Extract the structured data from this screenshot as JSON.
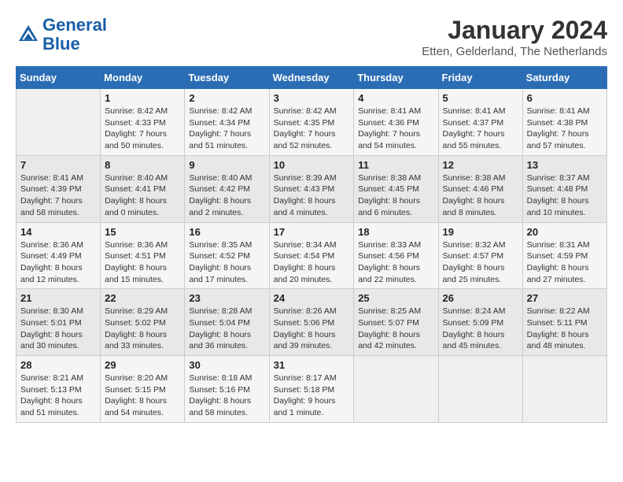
{
  "header": {
    "logo_line1": "General",
    "logo_line2": "Blue",
    "month_year": "January 2024",
    "location": "Etten, Gelderland, The Netherlands"
  },
  "days_of_week": [
    "Sunday",
    "Monday",
    "Tuesday",
    "Wednesday",
    "Thursday",
    "Friday",
    "Saturday"
  ],
  "weeks": [
    [
      {
        "day": "",
        "sunrise": "",
        "sunset": "",
        "daylight": ""
      },
      {
        "day": "1",
        "sunrise": "Sunrise: 8:42 AM",
        "sunset": "Sunset: 4:33 PM",
        "daylight": "Daylight: 7 hours and 50 minutes."
      },
      {
        "day": "2",
        "sunrise": "Sunrise: 8:42 AM",
        "sunset": "Sunset: 4:34 PM",
        "daylight": "Daylight: 7 hours and 51 minutes."
      },
      {
        "day": "3",
        "sunrise": "Sunrise: 8:42 AM",
        "sunset": "Sunset: 4:35 PM",
        "daylight": "Daylight: 7 hours and 52 minutes."
      },
      {
        "day": "4",
        "sunrise": "Sunrise: 8:41 AM",
        "sunset": "Sunset: 4:36 PM",
        "daylight": "Daylight: 7 hours and 54 minutes."
      },
      {
        "day": "5",
        "sunrise": "Sunrise: 8:41 AM",
        "sunset": "Sunset: 4:37 PM",
        "daylight": "Daylight: 7 hours and 55 minutes."
      },
      {
        "day": "6",
        "sunrise": "Sunrise: 8:41 AM",
        "sunset": "Sunset: 4:38 PM",
        "daylight": "Daylight: 7 hours and 57 minutes."
      }
    ],
    [
      {
        "day": "7",
        "sunrise": "Sunrise: 8:41 AM",
        "sunset": "Sunset: 4:39 PM",
        "daylight": "Daylight: 7 hours and 58 minutes."
      },
      {
        "day": "8",
        "sunrise": "Sunrise: 8:40 AM",
        "sunset": "Sunset: 4:41 PM",
        "daylight": "Daylight: 8 hours and 0 minutes."
      },
      {
        "day": "9",
        "sunrise": "Sunrise: 8:40 AM",
        "sunset": "Sunset: 4:42 PM",
        "daylight": "Daylight: 8 hours and 2 minutes."
      },
      {
        "day": "10",
        "sunrise": "Sunrise: 8:39 AM",
        "sunset": "Sunset: 4:43 PM",
        "daylight": "Daylight: 8 hours and 4 minutes."
      },
      {
        "day": "11",
        "sunrise": "Sunrise: 8:38 AM",
        "sunset": "Sunset: 4:45 PM",
        "daylight": "Daylight: 8 hours and 6 minutes."
      },
      {
        "day": "12",
        "sunrise": "Sunrise: 8:38 AM",
        "sunset": "Sunset: 4:46 PM",
        "daylight": "Daylight: 8 hours and 8 minutes."
      },
      {
        "day": "13",
        "sunrise": "Sunrise: 8:37 AM",
        "sunset": "Sunset: 4:48 PM",
        "daylight": "Daylight: 8 hours and 10 minutes."
      }
    ],
    [
      {
        "day": "14",
        "sunrise": "Sunrise: 8:36 AM",
        "sunset": "Sunset: 4:49 PM",
        "daylight": "Daylight: 8 hours and 12 minutes."
      },
      {
        "day": "15",
        "sunrise": "Sunrise: 8:36 AM",
        "sunset": "Sunset: 4:51 PM",
        "daylight": "Daylight: 8 hours and 15 minutes."
      },
      {
        "day": "16",
        "sunrise": "Sunrise: 8:35 AM",
        "sunset": "Sunset: 4:52 PM",
        "daylight": "Daylight: 8 hours and 17 minutes."
      },
      {
        "day": "17",
        "sunrise": "Sunrise: 8:34 AM",
        "sunset": "Sunset: 4:54 PM",
        "daylight": "Daylight: 8 hours and 20 minutes."
      },
      {
        "day": "18",
        "sunrise": "Sunrise: 8:33 AM",
        "sunset": "Sunset: 4:56 PM",
        "daylight": "Daylight: 8 hours and 22 minutes."
      },
      {
        "day": "19",
        "sunrise": "Sunrise: 8:32 AM",
        "sunset": "Sunset: 4:57 PM",
        "daylight": "Daylight: 8 hours and 25 minutes."
      },
      {
        "day": "20",
        "sunrise": "Sunrise: 8:31 AM",
        "sunset": "Sunset: 4:59 PM",
        "daylight": "Daylight: 8 hours and 27 minutes."
      }
    ],
    [
      {
        "day": "21",
        "sunrise": "Sunrise: 8:30 AM",
        "sunset": "Sunset: 5:01 PM",
        "daylight": "Daylight: 8 hours and 30 minutes."
      },
      {
        "day": "22",
        "sunrise": "Sunrise: 8:29 AM",
        "sunset": "Sunset: 5:02 PM",
        "daylight": "Daylight: 8 hours and 33 minutes."
      },
      {
        "day": "23",
        "sunrise": "Sunrise: 8:28 AM",
        "sunset": "Sunset: 5:04 PM",
        "daylight": "Daylight: 8 hours and 36 minutes."
      },
      {
        "day": "24",
        "sunrise": "Sunrise: 8:26 AM",
        "sunset": "Sunset: 5:06 PM",
        "daylight": "Daylight: 8 hours and 39 minutes."
      },
      {
        "day": "25",
        "sunrise": "Sunrise: 8:25 AM",
        "sunset": "Sunset: 5:07 PM",
        "daylight": "Daylight: 8 hours and 42 minutes."
      },
      {
        "day": "26",
        "sunrise": "Sunrise: 8:24 AM",
        "sunset": "Sunset: 5:09 PM",
        "daylight": "Daylight: 8 hours and 45 minutes."
      },
      {
        "day": "27",
        "sunrise": "Sunrise: 8:22 AM",
        "sunset": "Sunset: 5:11 PM",
        "daylight": "Daylight: 8 hours and 48 minutes."
      }
    ],
    [
      {
        "day": "28",
        "sunrise": "Sunrise: 8:21 AM",
        "sunset": "Sunset: 5:13 PM",
        "daylight": "Daylight: 8 hours and 51 minutes."
      },
      {
        "day": "29",
        "sunrise": "Sunrise: 8:20 AM",
        "sunset": "Sunset: 5:15 PM",
        "daylight": "Daylight: 8 hours and 54 minutes."
      },
      {
        "day": "30",
        "sunrise": "Sunrise: 8:18 AM",
        "sunset": "Sunset: 5:16 PM",
        "daylight": "Daylight: 8 hours and 58 minutes."
      },
      {
        "day": "31",
        "sunrise": "Sunrise: 8:17 AM",
        "sunset": "Sunset: 5:18 PM",
        "daylight": "Daylight: 9 hours and 1 minute."
      },
      {
        "day": "",
        "sunrise": "",
        "sunset": "",
        "daylight": ""
      },
      {
        "day": "",
        "sunrise": "",
        "sunset": "",
        "daylight": ""
      },
      {
        "day": "",
        "sunrise": "",
        "sunset": "",
        "daylight": ""
      }
    ]
  ]
}
